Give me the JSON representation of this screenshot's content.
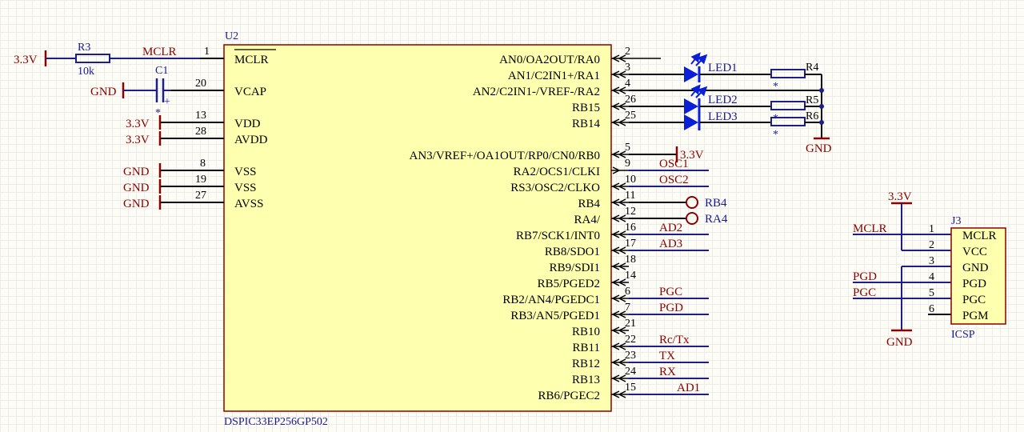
{
  "u2": {
    "ref": "U2",
    "part": "DSPIC33EP256GP502",
    "left_pins": [
      {
        "num": "1",
        "name": "MCLR"
      },
      {
        "num": "20",
        "name": "VCAP"
      },
      {
        "num": "13",
        "name": "VDD"
      },
      {
        "num": "28",
        "name": "AVDD"
      },
      {
        "num": "8",
        "name": "VSS"
      },
      {
        "num": "19",
        "name": "VSS"
      },
      {
        "num": "27",
        "name": "AVSS"
      }
    ],
    "right_pins": [
      {
        "num": "2",
        "name": "AN0/OA2OUT/RA0"
      },
      {
        "num": "3",
        "name": "AN1/C2IN1+/RA1"
      },
      {
        "num": "4",
        "name": "AN2/C2IN1-/VREF-/RA2"
      },
      {
        "num": "26",
        "name": "RB15"
      },
      {
        "num": "25",
        "name": "RB14"
      },
      {
        "num": "5",
        "name": "AN3/VREF+/OA1OUT/RP0/CN0/RB0"
      },
      {
        "num": "9",
        "name": "RA2/OCS1/CLKI"
      },
      {
        "num": "10",
        "name": "RS3/OSC2/CLKO"
      },
      {
        "num": "11",
        "name": "RB4"
      },
      {
        "num": "12",
        "name": "RA4/"
      },
      {
        "num": "16",
        "name": "RB7/SCK1/INT0"
      },
      {
        "num": "17",
        "name": "RB8/SDO1"
      },
      {
        "num": "18",
        "name": "RB9/SDI1"
      },
      {
        "num": "14",
        "name": "RB5/PGED2"
      },
      {
        "num": "6",
        "name": "RB2/AN4/PGEDC1"
      },
      {
        "num": "7",
        "name": "RB3/AN5/PGED1"
      },
      {
        "num": "21",
        "name": "RB10"
      },
      {
        "num": "22",
        "name": "RB11"
      },
      {
        "num": "23",
        "name": "RB12"
      },
      {
        "num": "24",
        "name": "RB13"
      },
      {
        "num": "15",
        "name": "RB6/PGEC2"
      }
    ]
  },
  "left_nets": {
    "mclr_power": "3.3V",
    "r3_ref": "R3",
    "r3_value": "10k",
    "mclr_net": "MCLR",
    "c1_ref": "C1",
    "cap_gnd": "GND",
    "vdd_power": "3.3V",
    "avdd_power": "3.3V",
    "vss1_gnd": "GND",
    "vss2_gnd": "GND",
    "avss_gnd": "GND",
    "star": "*"
  },
  "right_nets": {
    "rb0_power": "3.3V",
    "osc1": "OSC1",
    "osc2": "OSC2",
    "rb4_port": "RB4",
    "ra4_port": "RA4",
    "ad2": "AD2",
    "ad3": "AD3",
    "pgc": "PGC",
    "pgd": "PGD",
    "rctx": "Rc/Tx",
    "tx": "TX",
    "rx": "RX",
    "ad1": "AD1"
  },
  "leds": {
    "led1": "LED1",
    "led2": "LED2",
    "led3": "LED3",
    "r4": "R4",
    "r5": "R5",
    "r6": "R6",
    "gnd": "GND",
    "star": "*"
  },
  "j3": {
    "ref": "J3",
    "name": "ICSP",
    "power": "3.3V",
    "gnd": "GND",
    "mclr_net": "MCLR",
    "pgd_net": "PGD",
    "pgc_net": "PGC",
    "pins": [
      {
        "num": "1",
        "name": "MCLR"
      },
      {
        "num": "2",
        "name": "VCC"
      },
      {
        "num": "3",
        "name": "GND"
      },
      {
        "num": "4",
        "name": "PGD"
      },
      {
        "num": "5",
        "name": "PGC"
      },
      {
        "num": "6",
        "name": "PGM"
      }
    ]
  },
  "colors": {
    "body": "#ffffb0",
    "wire": "#1e1e8a",
    "net_label": "#8b0000",
    "led": "#0b1fd6"
  }
}
